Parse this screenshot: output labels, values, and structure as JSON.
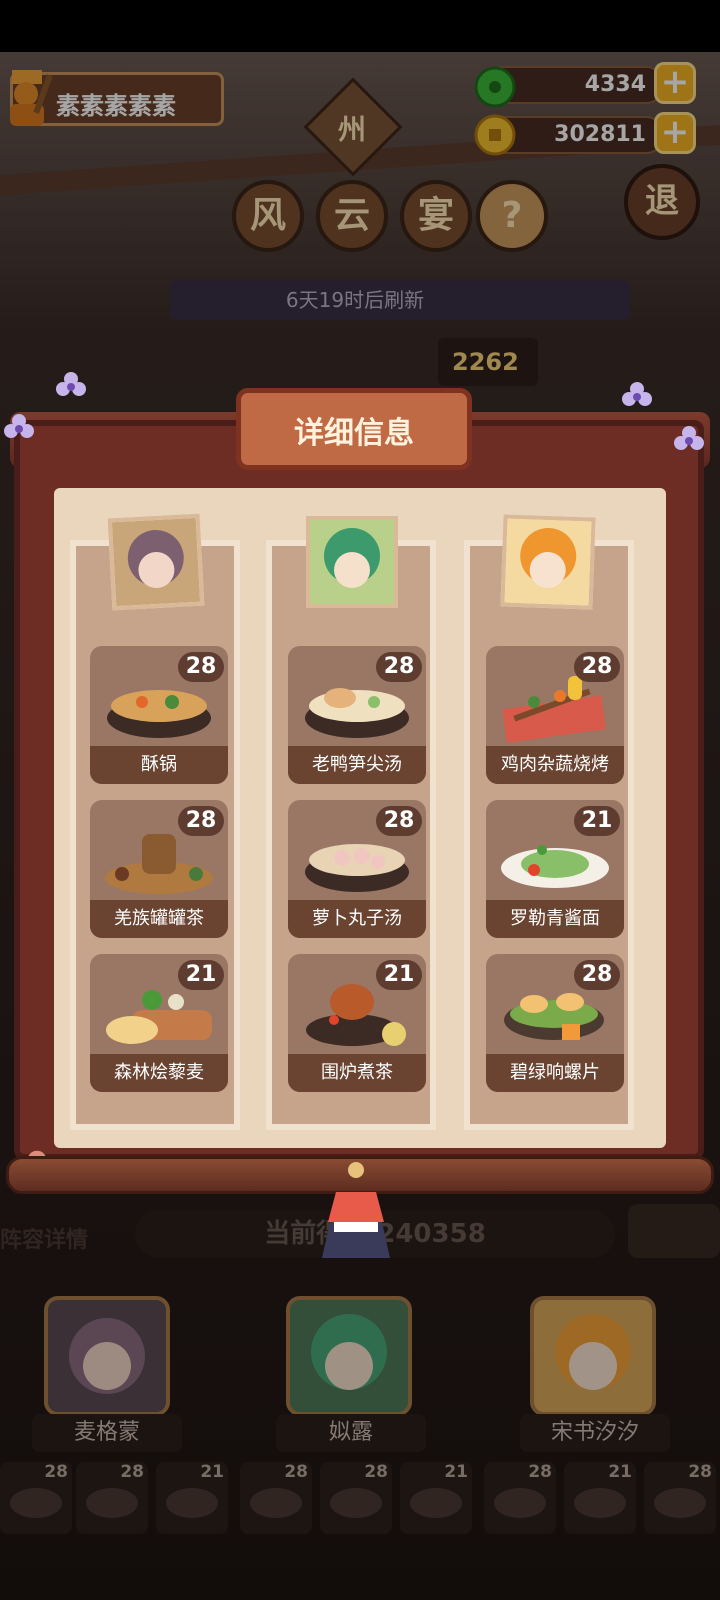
{
  "player": {
    "name": "素素素素素"
  },
  "currencies": [
    {
      "name": "jade",
      "value": "4334"
    },
    {
      "name": "coins",
      "value": "302811"
    }
  ],
  "event": {
    "badge": "州",
    "title_chars": [
      "风",
      "云",
      "宴"
    ],
    "help": "?",
    "refresh_text": "6天19时后刷新",
    "exit": "退",
    "score_partial": "2262"
  },
  "bottom": {
    "lineup_detail": "阵容详情",
    "current_score": "当前得分 240358",
    "heroes": [
      {
        "name": "麦格蒙"
      },
      {
        "name": "姒露"
      },
      {
        "name": "宋书汐汐"
      }
    ],
    "dish_counts": [
      "28",
      "28",
      "21",
      "28",
      "28",
      "21",
      "28",
      "21",
      "28"
    ]
  },
  "modal": {
    "title": "详细信息",
    "columns": [
      {
        "dishes": [
          {
            "name": "酥锅",
            "count": "28"
          },
          {
            "name": "羌族罐罐茶",
            "count": "28"
          },
          {
            "name": "森林烩藜麦",
            "count": "21"
          }
        ]
      },
      {
        "dishes": [
          {
            "name": "老鸭笋尖汤",
            "count": "28"
          },
          {
            "name": "萝卜丸子汤",
            "count": "28"
          },
          {
            "name": "围炉煮茶",
            "count": "21"
          }
        ]
      },
      {
        "dishes": [
          {
            "name": "鸡肉杂蔬烧烤",
            "count": "28"
          },
          {
            "name": "罗勒青酱面",
            "count": "21"
          },
          {
            "name": "碧绿响螺片",
            "count": "28"
          }
        ]
      }
    ]
  },
  "colors": {
    "accent": "#f3b323",
    "frame": "#6d2c24",
    "paper": "#e9d6bc",
    "card": "#9a7764",
    "label": "#6a4331"
  }
}
